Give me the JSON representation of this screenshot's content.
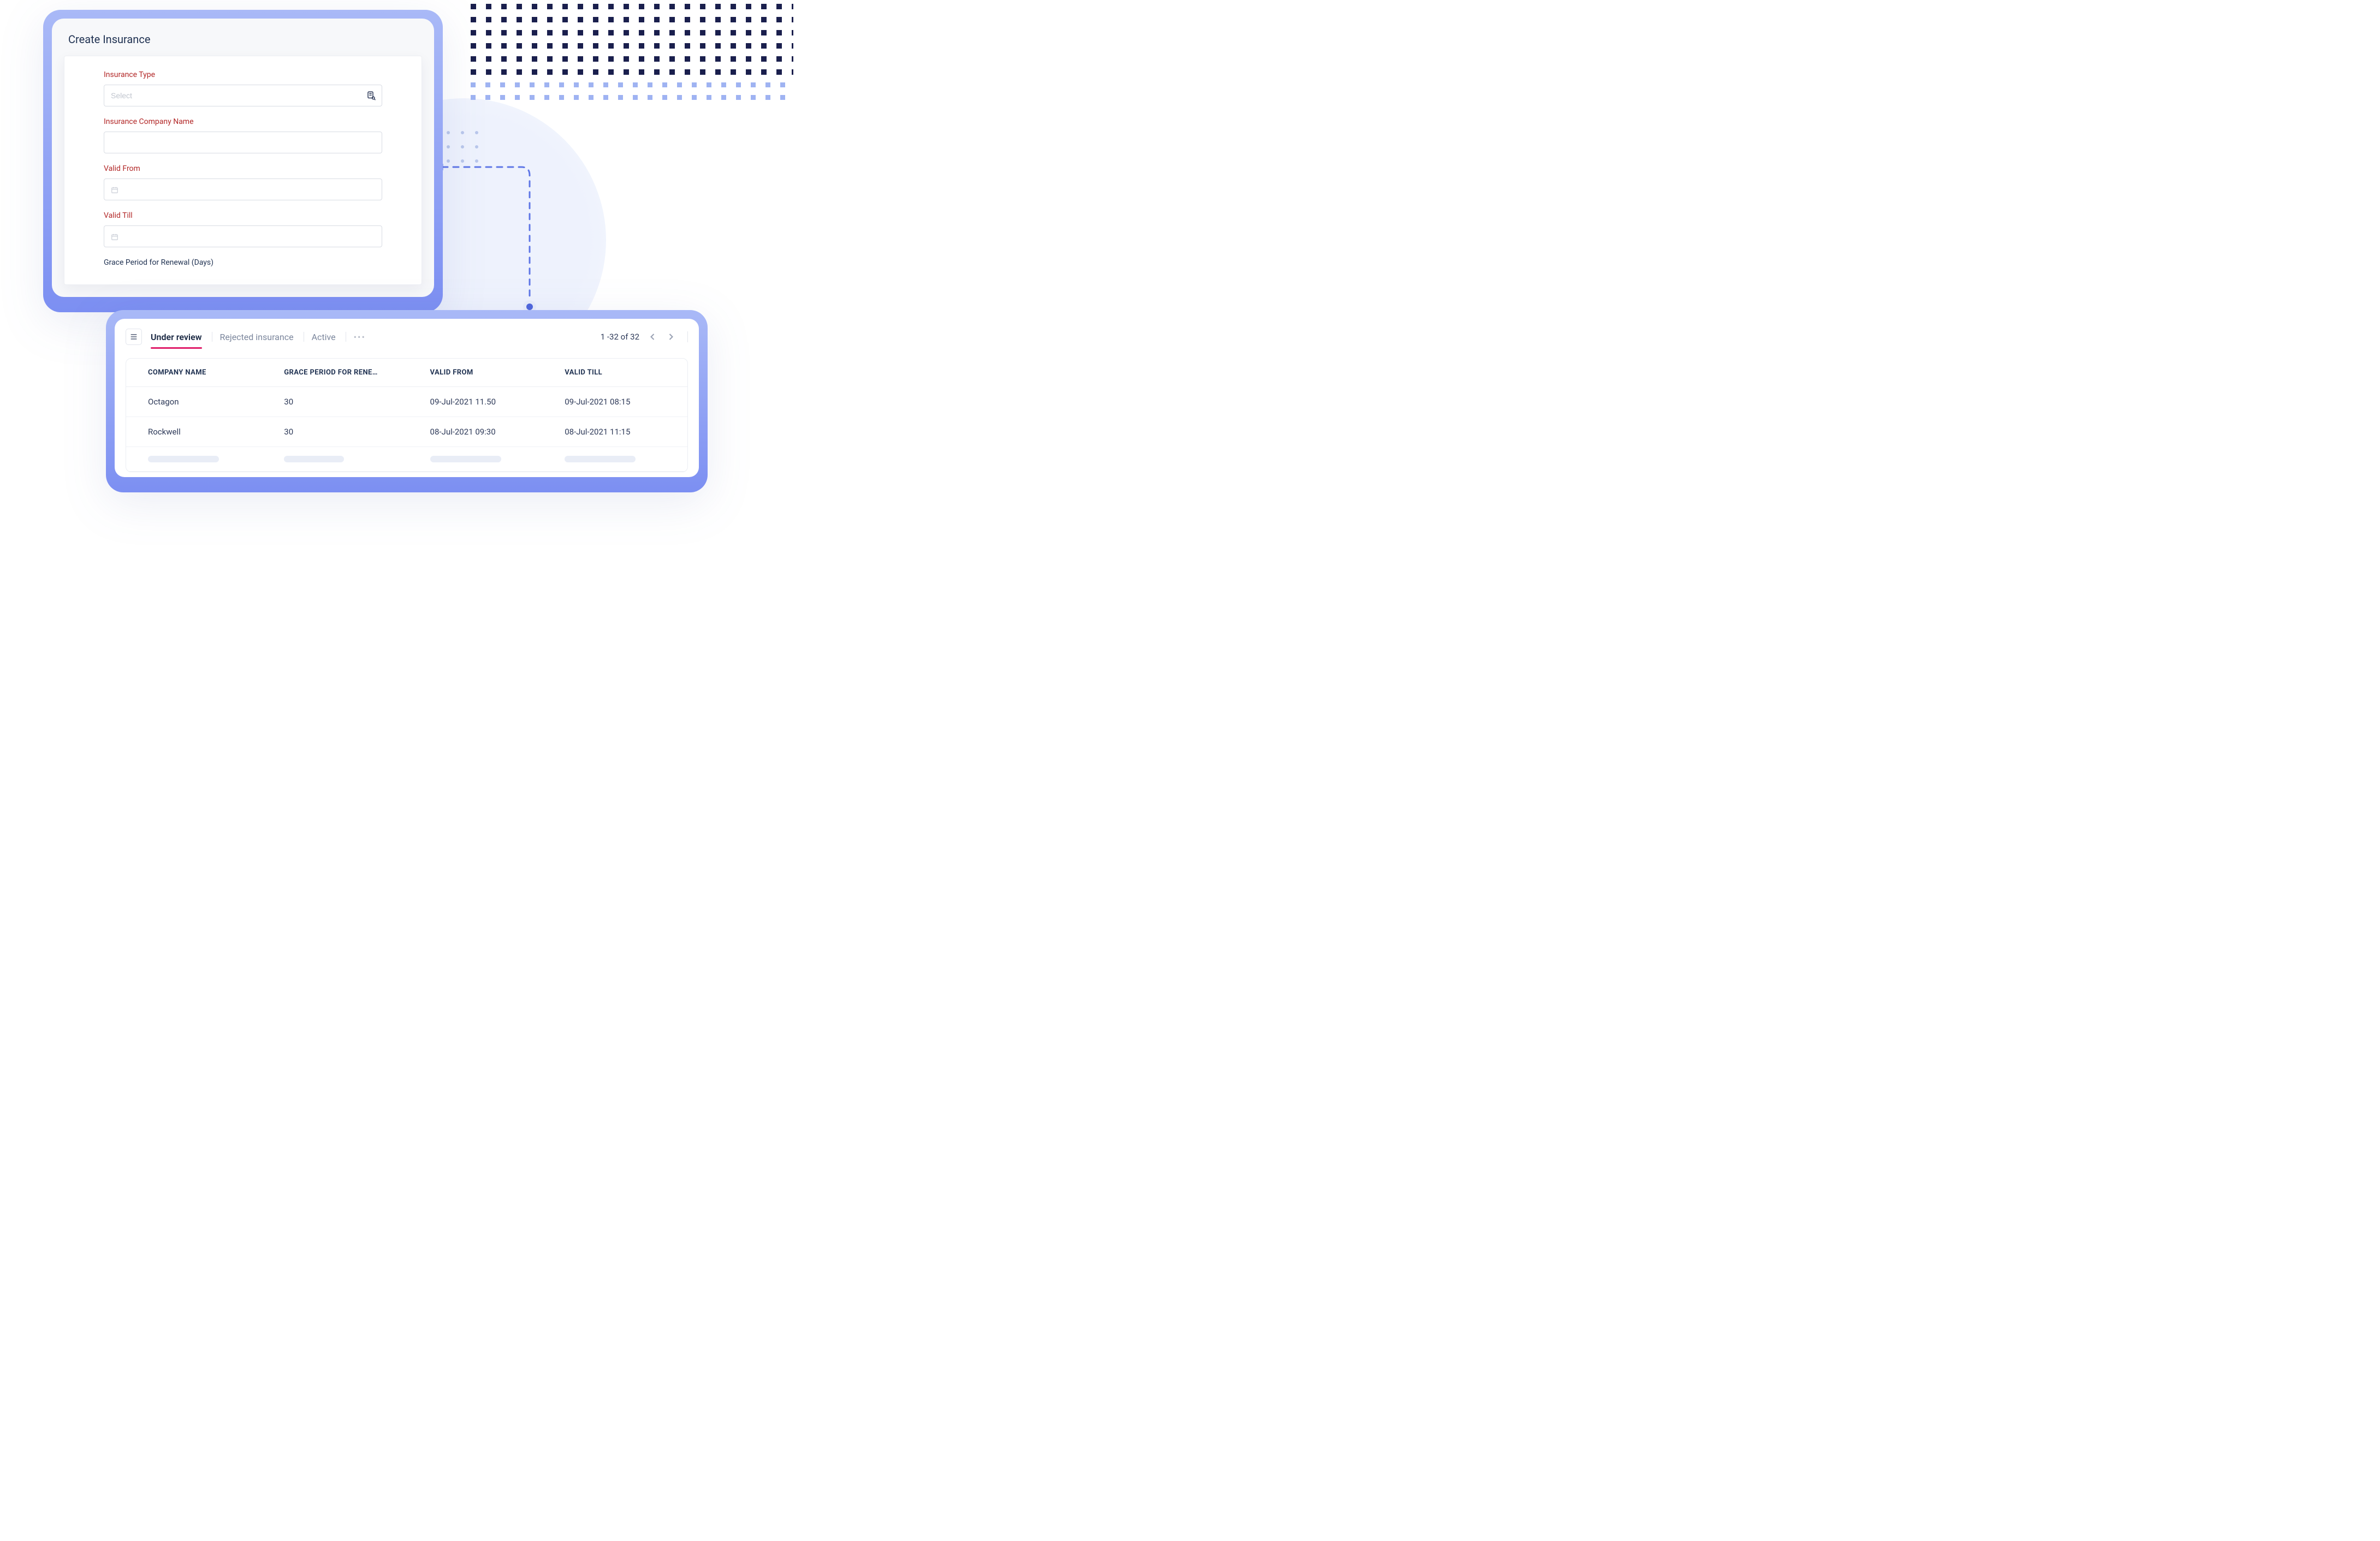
{
  "form": {
    "title": "Create Insurance",
    "fields": {
      "insurance_type": {
        "label": "Insurance Type",
        "placeholder": "Select",
        "value": ""
      },
      "company_name": {
        "label": "Insurance Company Name",
        "placeholder": "",
        "value": ""
      },
      "valid_from": {
        "label": "Valid From",
        "placeholder": "",
        "value": ""
      },
      "valid_till": {
        "label": "Valid Till",
        "placeholder": "",
        "value": ""
      },
      "grace_period": {
        "label": "Grace Period for Renewal (Days)"
      }
    }
  },
  "list": {
    "tabs": [
      {
        "label": "Under review",
        "active": true
      },
      {
        "label": "Rejected insurance",
        "active": false
      },
      {
        "label": "Active",
        "active": false
      }
    ],
    "pager": {
      "text": "1 -32 of 32"
    },
    "columns": {
      "company": "COMPANY NAME",
      "grace": "GRACE PERIOD FOR RENE…",
      "from": "VALID FROM",
      "till": "VALID TILL"
    },
    "rows": [
      {
        "company": "Octagon",
        "grace": "30",
        "from": "09-Jul-2021 11.50",
        "till": "09-Jul-2021 08:15"
      },
      {
        "company": "Rockwell",
        "grace": "30",
        "from": "08-Jul-2021 09:30",
        "till": "08-Jul-2021 11:15"
      }
    ]
  }
}
